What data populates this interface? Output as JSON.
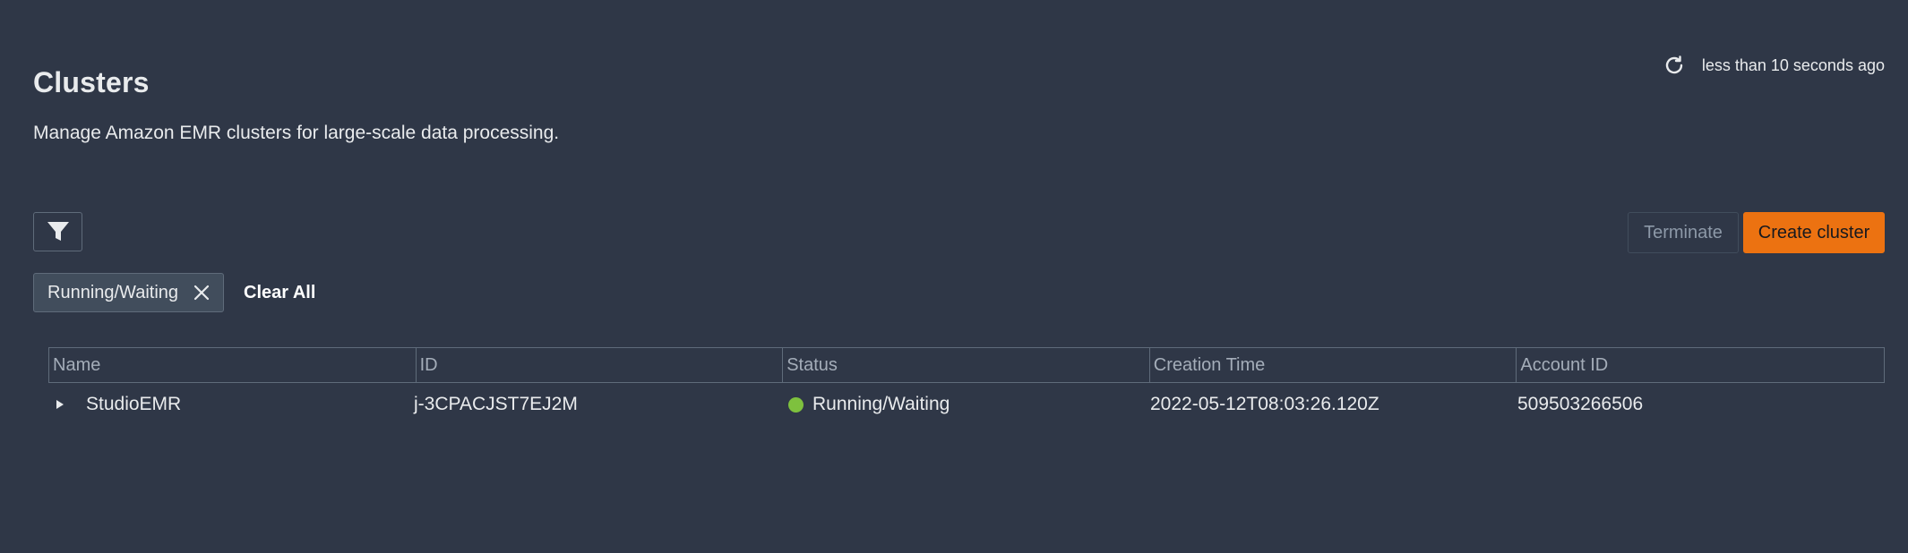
{
  "header": {
    "title": "Clusters",
    "subtitle": "Manage Amazon EMR clusters for large-scale data processing.",
    "refresh_text": "less than 10 seconds ago"
  },
  "toolbar": {
    "filter_icon": "filter-icon",
    "terminate_label": "Terminate",
    "create_label": "Create cluster"
  },
  "filters": {
    "tokens": [
      "Running/Waiting"
    ],
    "clear_all_label": "Clear All"
  },
  "table": {
    "columns": [
      "Name",
      "ID",
      "Status",
      "Creation Time",
      "Account ID"
    ],
    "rows": [
      {
        "name": "StudioEMR",
        "id": "j-3CPACJST7EJ2M",
        "status": "Running/Waiting",
        "creation_time": "2022-05-12T08:03:26.120Z",
        "account_id": "509503266506"
      }
    ]
  },
  "colors": {
    "background": "#2f3747",
    "primary_button": "#ec7211",
    "status_running": "#7ec13e"
  }
}
